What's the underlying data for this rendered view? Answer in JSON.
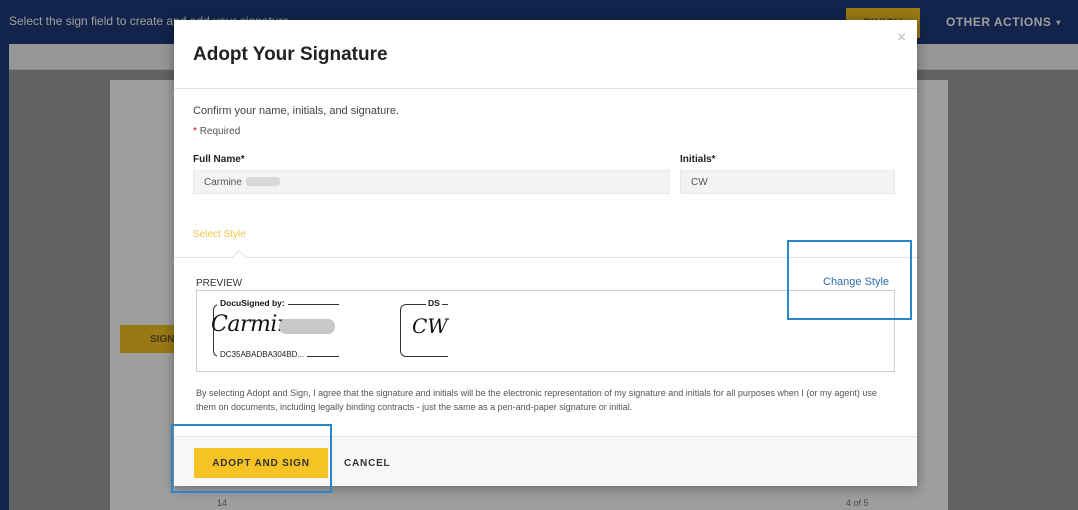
{
  "topbar": {
    "message": "Select the sign field to create and add your signature",
    "finish_label": "FINISH",
    "other_actions_label": "OTHER ACTIONS",
    "other_actions_caret": "▾"
  },
  "document": {
    "sign_tab_label": "SIGN",
    "page_number": "14",
    "page_count": "4 of 5"
  },
  "modal": {
    "close_glyph": "×",
    "title": "Adopt Your Signature",
    "instructions": "Confirm your name, initials, and signature.",
    "required_star": "*",
    "required_note": "Required",
    "full_name": {
      "label": "Full Name*",
      "value": "Carmine"
    },
    "initials": {
      "label": "Initials*",
      "value": "CW"
    },
    "style_tab_label": "Select Style",
    "preview_label": "PREVIEW",
    "change_style_label": "Change Style",
    "signature": {
      "header": "DocuSigned by:",
      "script": "Carmine",
      "id": "DC35ABADBA304BD..."
    },
    "initials_preview": {
      "header": "DS",
      "script": "CW"
    },
    "legal_text": "By selecting Adopt and Sign, I agree that the signature and initials will be the electronic representation of my signature and initials for all purposes when I (or my agent) use them on documents, including legally binding contracts - just the same as a pen-and-paper signature or initial.",
    "adopt_label": "ADOPT AND SIGN",
    "cancel_label": "CANCEL"
  },
  "colors": {
    "topbar": "#1e3a7a",
    "accent_yellow": "#f6c324",
    "link_blue": "#2e6fb0",
    "highlight": "#2b86c8"
  }
}
